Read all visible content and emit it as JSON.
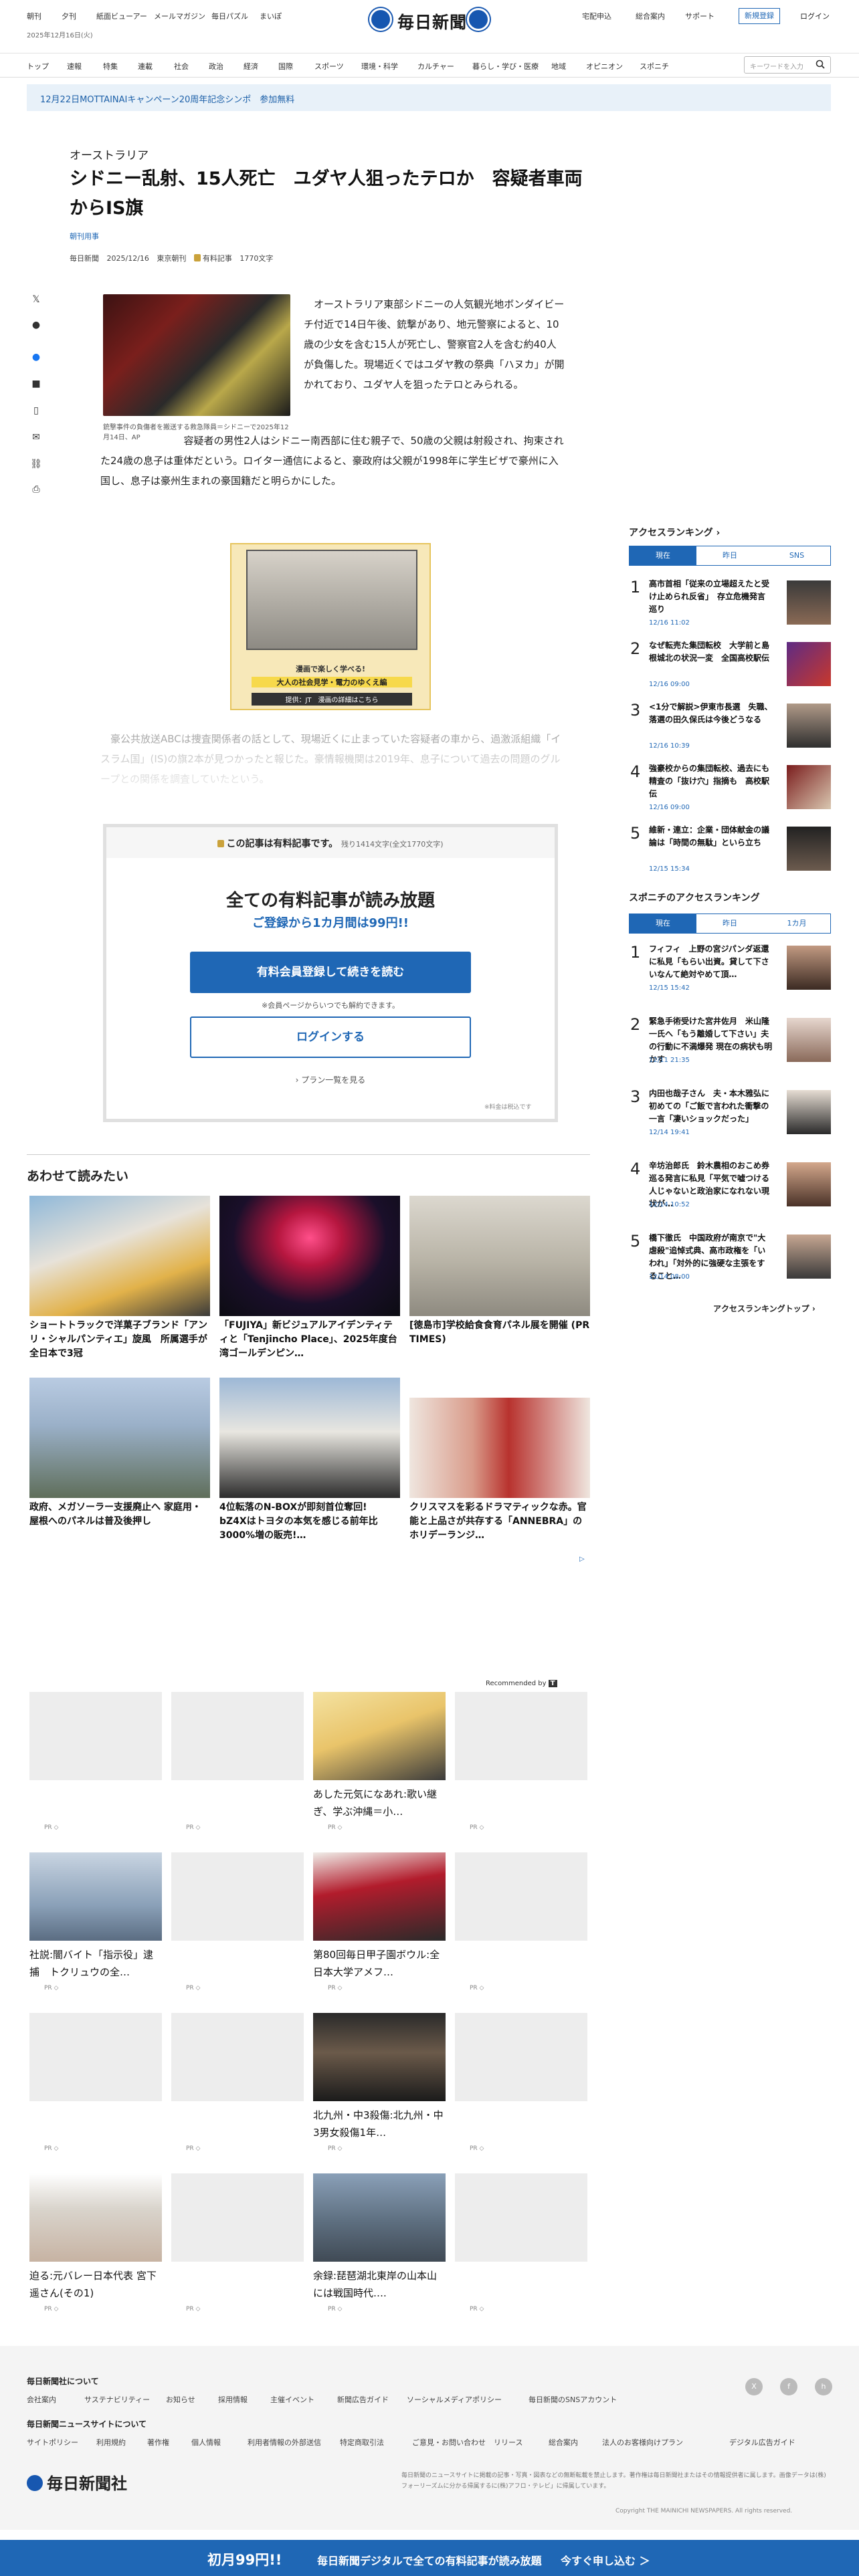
{
  "header": {
    "left_links": [
      "朝刊",
      "夕刊",
      "紙面ビューアー",
      "メールマガジン",
      "毎日パズル",
      "まいぽ"
    ],
    "date": "2025年12月16日(火)",
    "logo": "毎日新聞",
    "right_links": [
      "宅配申込",
      "総合案内",
      "サポート"
    ],
    "register": "新規登録",
    "login": "ログイン",
    "nav": [
      "トップ",
      "速報",
      "特集",
      "連載",
      "社会",
      "政治",
      "経済",
      "国際",
      "スポーツ",
      "環境・科学",
      "カルチャー",
      "暮らし・学び・医療",
      "地域",
      "オピニオン",
      "スポニチ"
    ],
    "search_placeholder": "キーワードを入力",
    "banner": "12月22日MOTTAINAIキャンペーン20周年記念シンポ　参加無料"
  },
  "article": {
    "kicker": "オーストラリア",
    "title": "シドニー乱射、15人死亡　ユダヤ人狙ったテロか　容疑者車両からIS旗",
    "mokuji": "朝刊用事",
    "meta": [
      "毎日新聞",
      "2025/12/16",
      "東京朝刊",
      "有料記事",
      "1770文字"
    ],
    "photo_caption": "銃撃事件の負傷者を搬送する救急隊員＝シドニーで2025年12月14日、AP",
    "p1": "オーストラリア東部シドニーの人気観光地ボンダイビーチ付近で14日午後、銃撃があり、地元警察によると、10歳の少女を含む15人が死亡し、警察官2人を含む約40人が負傷した。現場近くではユダヤ教の祭典「ハヌカ」が開かれており、ユダヤ人を狙ったテロとみられる。",
    "p2": "容疑者の男性2人はシドニー南西部に住む親子で、50歳の父親は射殺され、拘束された24歳の息子は重体だという。ロイター通信によると、豪政府は父親が1998年に学生ビザで豪州に入国し、息子は豪州生まれの豪国籍だと明らかにした。",
    "fade": "豪公共放送ABCは捜査関係者の話として、現場近くに止まっていた容疑者の車から、過激派組織「イスラム国」(IS)の旗2本が見つかったと報じた。豪情報機関は2019年、息子について過去の問題のグループとの関係を調査していたという。",
    "ad": {
      "t1": "漫画で楽しく学べる!",
      "t2": "大人の社会見学・電力のゆくえ編",
      "t3": "提供：JT　漫画の詳細はこちら"
    }
  },
  "paywall": {
    "head": "この記事は有料記事です。",
    "remaining": "残り1414文字(全文1770文字)",
    "h1": "全ての有料記事が読み放題",
    "h2": "ご登録から1カ月間は99円!!",
    "btn_register": "有料会員登録して続きを読む",
    "note": "※会員ページからいつでも解約できます。",
    "btn_login": "ログインする",
    "plans": "プラン一覧を見る",
    "tax": "※料金は税込です"
  },
  "also_read": {
    "heading": "あわせて読みたい",
    "items": [
      {
        "title": "ショートトラックで洋菓子ブランド「アンリ・シャルパンティエ」旋風　所属選手が全日本で3冠"
      },
      {
        "title": "「FUJIYA」新ビジュアルアイデンティティと「Tenjincho Place」、2025年度台湾ゴールデンピン…"
      },
      {
        "title": "[徳島市]学校給食食育パネル展を開催 (PR TIMES)"
      },
      {
        "title": "政府、メガソーラー支援廃止へ 家庭用・屋根へのパネルは普及後押し"
      },
      {
        "title": "4位転落のN-BOXが即刻首位奪回!　bZ4Xはトヨタの本気を感じる前年比3000%増の販売!…"
      },
      {
        "title": "クリスマスを彩るドラマティックな赤。官能と上品さが共存する「ANNEBRA」のホリデーランジ…"
      }
    ]
  },
  "recommended": {
    "by": "Recommended by",
    "pr": "PR ◇",
    "items": [
      {
        "title": ""
      },
      {
        "title": ""
      },
      {
        "title": "あした元気になあれ:歌い継ぎ、学ぶ沖縄＝小…"
      },
      {
        "title": ""
      },
      {
        "title": "社説:闇バイト「指示役」逮捕　トクリュウの全…"
      },
      {
        "title": ""
      },
      {
        "title": "第80回毎日甲子園ボウル:全日本大学アメフ…"
      },
      {
        "title": ""
      },
      {
        "title": ""
      },
      {
        "title": ""
      },
      {
        "title": "北九州・中3殺傷:北九州・中3男女殺傷1年…"
      },
      {
        "title": ""
      },
      {
        "title": "迫る:元バレー日本代表 宮下遥さん(その1)"
      },
      {
        "title": ""
      },
      {
        "title": "余録:琵琶湖北東岸の山本山には戦国時代…."
      },
      {
        "title": ""
      }
    ]
  },
  "ranking": {
    "heading": "アクセスランキング",
    "tabs": [
      "現在",
      "昨日",
      "SNS"
    ],
    "items": [
      {
        "n": "1",
        "title": "高市首相「従来の立場超えたと受け止められ反省」　存立危機発言巡り",
        "date": "12/16 11:02"
      },
      {
        "n": "2",
        "title": "なぜ転売た集団転校　大学前と島根城北の状況一変　全国高校駅伝",
        "date": "12/16 09:00"
      },
      {
        "n": "3",
        "title": "<1分で解説>伊東市長選　失職、落選の田久保氏は今後どうなる",
        "date": "12/16 10:39"
      },
      {
        "n": "4",
        "title": "強豪校からの集団転校、過去にも　精査の「抜け穴」指摘も　高校駅伝",
        "date": "12/16 09:00"
      },
      {
        "n": "5",
        "title": "維新・連立：企業・団体献金の議論は「時間の無駄」といら立ち",
        "date": "12/15 15:34"
      }
    ],
    "more": "アクセスランキングトップ"
  },
  "sponichi": {
    "heading": "スポニチのアクセスランキング",
    "tabs": [
      "現在",
      "昨日",
      "1カ月"
    ],
    "items": [
      {
        "n": "1",
        "title": "フィフィ　上野の宮ジパンダ返還に私見「もらい出資。貸して下さいなんて絶対やめて頂…",
        "date": "12/15 15:42"
      },
      {
        "n": "2",
        "title": "緊急手術受けた宮井佐月　米山隆一氏へ「もう離婚して下さい」夫の行動に不満爆発 現在の病状も明かす",
        "date": "12/11 21:35"
      },
      {
        "n": "3",
        "title": "内田也哉子さん　夫・本木雅弘に初めての「ご飯で言われた衝撃の一言「凄いショックだった」",
        "date": "12/14 19:41"
      },
      {
        "n": "4",
        "title": "辛坊治郎氏　鈴木農相のおこめ券巡る発言に私見「平気で嘘つける人じゃないと政治家になれない現状が…",
        "date": "12/14 10:52"
      },
      {
        "n": "5",
        "title": "橋下徹氏　中国政府が南京で\"大虐殺\"追悼式典、高市政権を「いわれ」「対外的に強硬な主張をすること…",
        "date": "12/14 08:00"
      }
    ]
  },
  "footer": {
    "about_heading": "毎日新聞社について",
    "about_links": [
      "会社案内",
      "サステナビリティー",
      "お知らせ",
      "採用情報",
      "主催イベント",
      "新聞広告ガイド",
      "ソーシャルメディアポリシー",
      "毎日新聞のSNSアカウント"
    ],
    "site_heading": "毎日新聞ニュースサイトについて",
    "site_links": [
      "サイトポリシー",
      "利用規約",
      "著作権",
      "個人情報",
      "利用者情報の外部送信",
      "特定商取引法",
      "ご意見・お問い合わせ",
      "リリース",
      "総合案内",
      "法人のお客様向けプラン",
      "デジタル広告ガイド"
    ],
    "social": [
      "X",
      "f",
      "h"
    ],
    "logo": "毎日新聞社",
    "note": "毎日新聞のニュースサイトに掲載の記事・写真・図表などの無断転載を禁止します。著作権は毎日新聞社またはその情報提供者に属します。画像データは(株)フォーリーズムに分かる帰属するに(株)アフロ・テレビ」に帰属しています。",
    "copyright": "Copyright THE MAINICHI NEWSPAPERS. All rights reserved."
  },
  "cta": {
    "a": "初月99円!!",
    "b": "毎日新聞デジタルで全ての有料記事が読み放題",
    "c": "今すぐ申し込む ＞"
  },
  "colors": {
    "accent": "#1f67b5",
    "banner_bg": "#e8f1f9",
    "footer_bg": "#f4f4f4"
  }
}
